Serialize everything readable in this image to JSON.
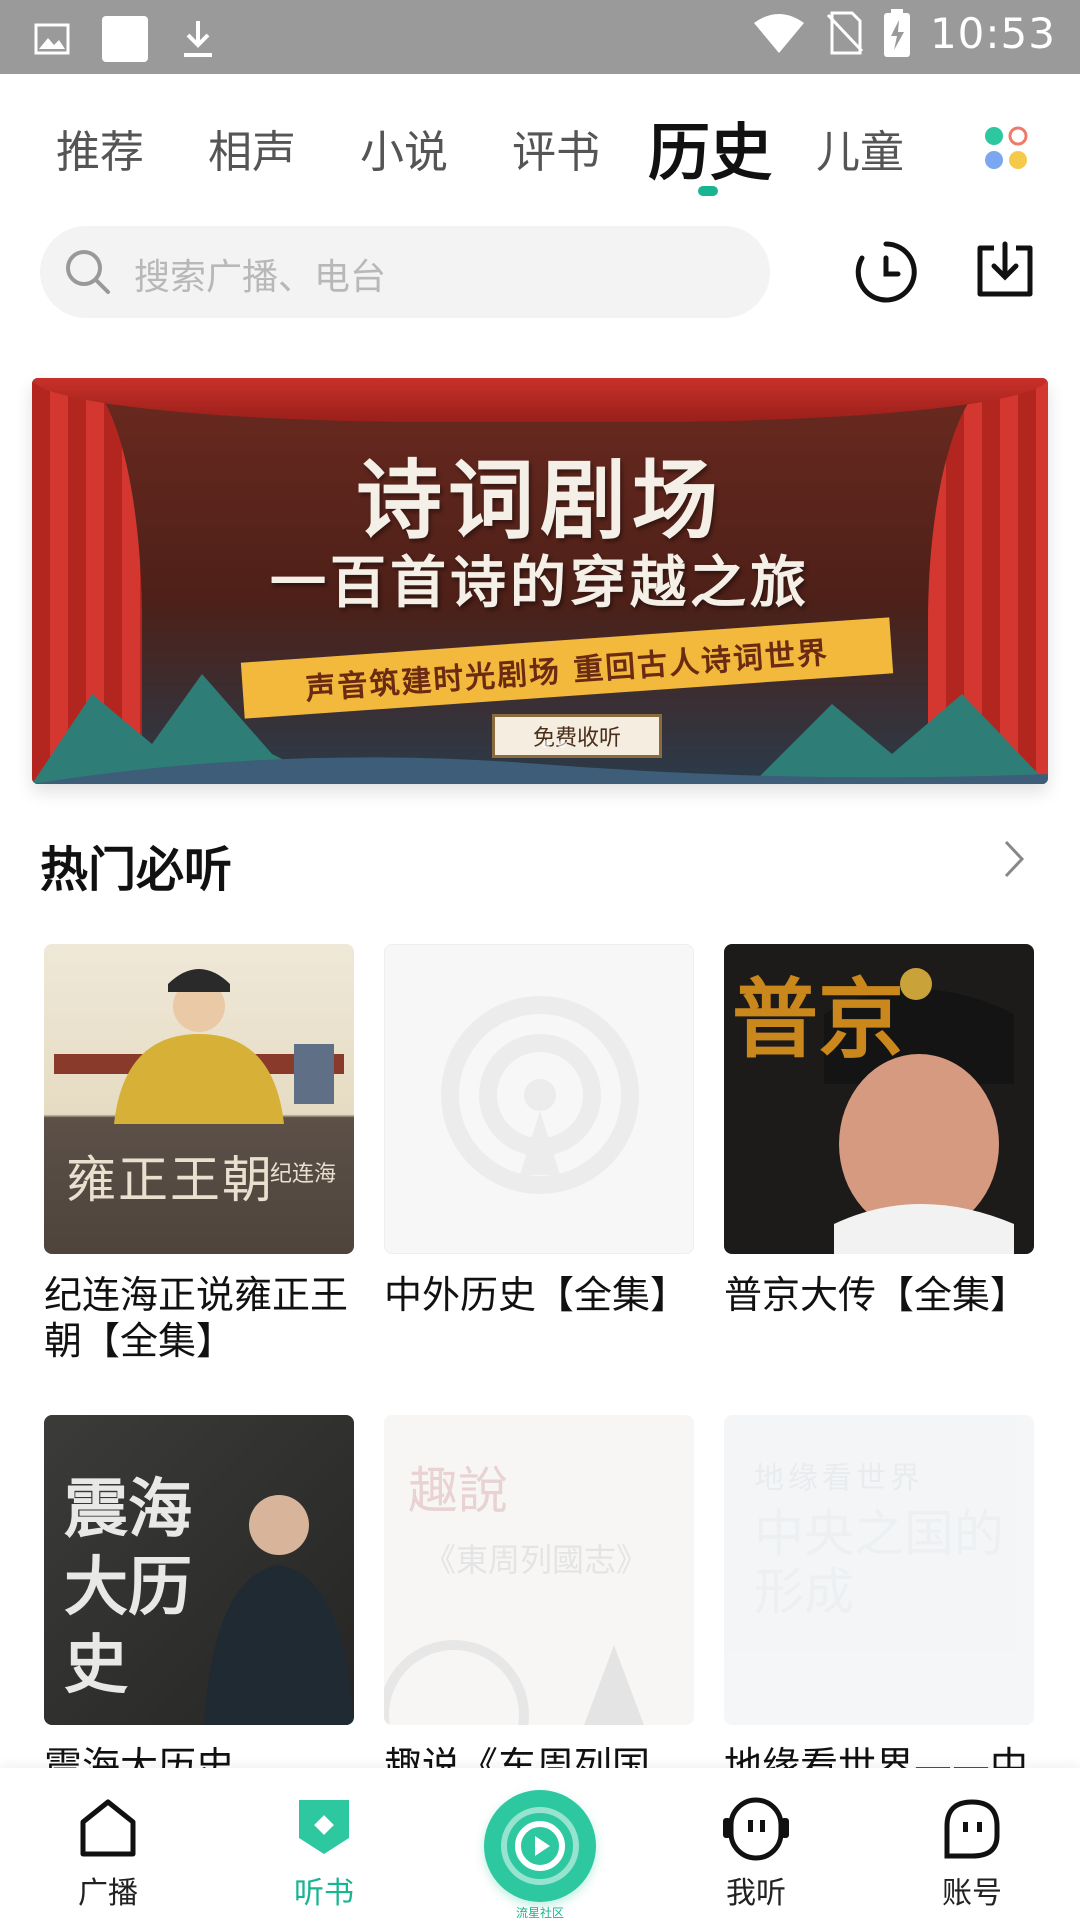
{
  "status_bar": {
    "time": "10:53"
  },
  "tabs": [
    {
      "label": "推荐"
    },
    {
      "label": "相声"
    },
    {
      "label": "小说"
    },
    {
      "label": "评书"
    },
    {
      "label": "历史",
      "active": true
    },
    {
      "label": "儿童"
    }
  ],
  "search": {
    "placeholder": "搜索广播、电台"
  },
  "banner": {
    "title": "诗词剧场",
    "subtitle": "一百首诗的穿越之旅",
    "ribbon": "声音筑建时光剧场  重回古人诗词世界",
    "button": "免费收听"
  },
  "section": {
    "title": "热门必听"
  },
  "cards": [
    {
      "title": "纪连海正说雍正王朝【全集】",
      "cover_text": "雍正王朝",
      "cover_sub": "纪连海"
    },
    {
      "title": "中外历史【全集】"
    },
    {
      "title": "普京大传【全集】",
      "cover_text": "普京"
    },
    {
      "title": "震海大历史",
      "cover_text": "震海大历史"
    },
    {
      "title": "趣说《东周列国",
      "cover_text": "趣說",
      "cover_sub": "《東周列國志》"
    },
    {
      "title": "地缘看世界——中",
      "cover_text": "地缘看世界",
      "cover_sub": "中央之国的形成"
    }
  ],
  "bottom_nav": {
    "items": [
      {
        "label": "广播",
        "icon": "home-icon"
      },
      {
        "label": "听书",
        "icon": "book-tag-icon",
        "active": true
      },
      {
        "label": "我听",
        "icon": "listen-face-icon"
      },
      {
        "label": "账号",
        "icon": "account-face-icon"
      }
    ],
    "center_label": "流星社区"
  },
  "colors": {
    "accent": "#18b592",
    "center_button": "#2dc7a0"
  }
}
